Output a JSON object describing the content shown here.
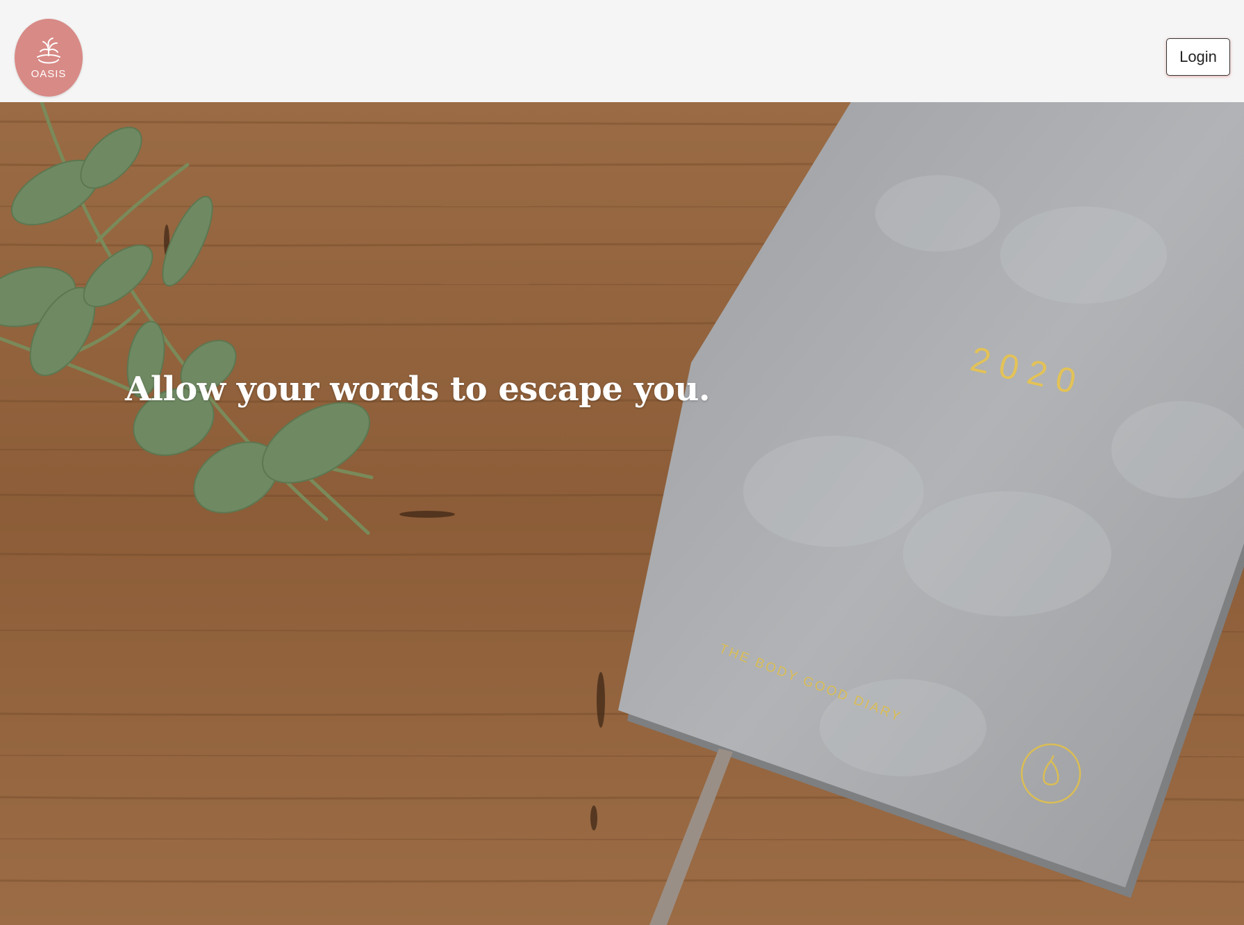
{
  "header": {
    "logo_text": "OASIS",
    "login_label": "Login"
  },
  "hero": {
    "headline": "Allow your words to escape you.",
    "diary_year": "2020",
    "diary_brand": "THE BODY GOOD DIARY"
  },
  "colors": {
    "brand": "#d88a86",
    "header_bg": "#f5f5f5",
    "gold": "#e3c257"
  }
}
